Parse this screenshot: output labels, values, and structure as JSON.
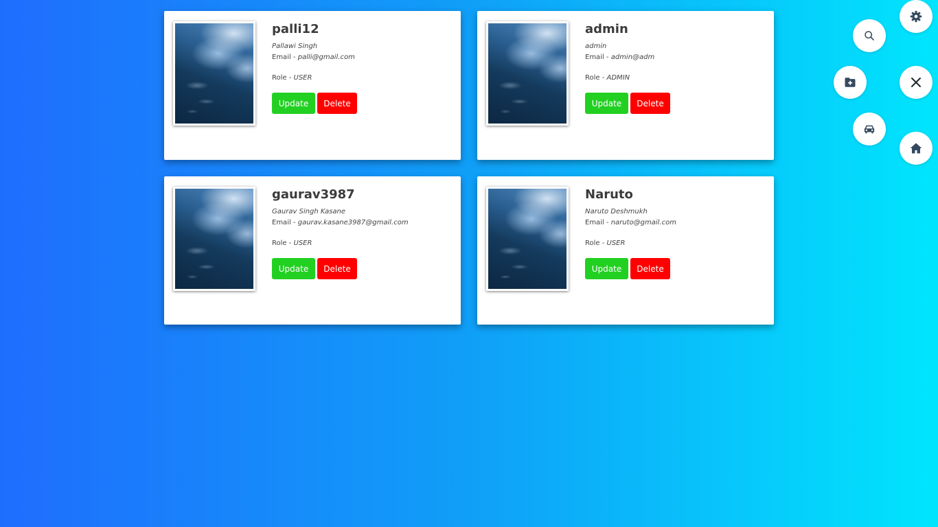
{
  "users": [
    {
      "username": "palli12",
      "full_name": "Pallawi Singh",
      "email_label": "Email - ",
      "email": "palli@gmail.com",
      "role_label": "Role - ",
      "role": "USER",
      "update_label": "Update",
      "delete_label": "Delete"
    },
    {
      "username": "admin",
      "full_name": "admin",
      "email_label": "Email - ",
      "email": "admin@adm",
      "role_label": "Role - ",
      "role": "ADMIN",
      "update_label": "Update",
      "delete_label": "Delete"
    },
    {
      "username": "gaurav3987",
      "full_name": "Gaurav Singh Kasane",
      "email_label": "Email - ",
      "email": "gaurav.kasane3987@gmail.com",
      "role_label": "Role - ",
      "role": "USER",
      "update_label": "Update",
      "delete_label": "Delete"
    },
    {
      "username": "Naruto",
      "full_name": "Naruto Deshmukh",
      "email_label": "Email - ",
      "email": "naruto@gmail.com",
      "role_label": "Role - ",
      "role": "USER",
      "update_label": "Update",
      "delete_label": "Delete"
    }
  ],
  "fab_menu": {
    "items": [
      "gear-icon",
      "search-icon",
      "folder-plus-icon",
      "close-icon",
      "car-icon",
      "home-icon"
    ]
  },
  "colors": {
    "background_start": "#1f6dfd",
    "background_end": "#00e5fd",
    "update_button": "#22d022",
    "delete_button": "#ff0000",
    "icon": "#34495e"
  }
}
